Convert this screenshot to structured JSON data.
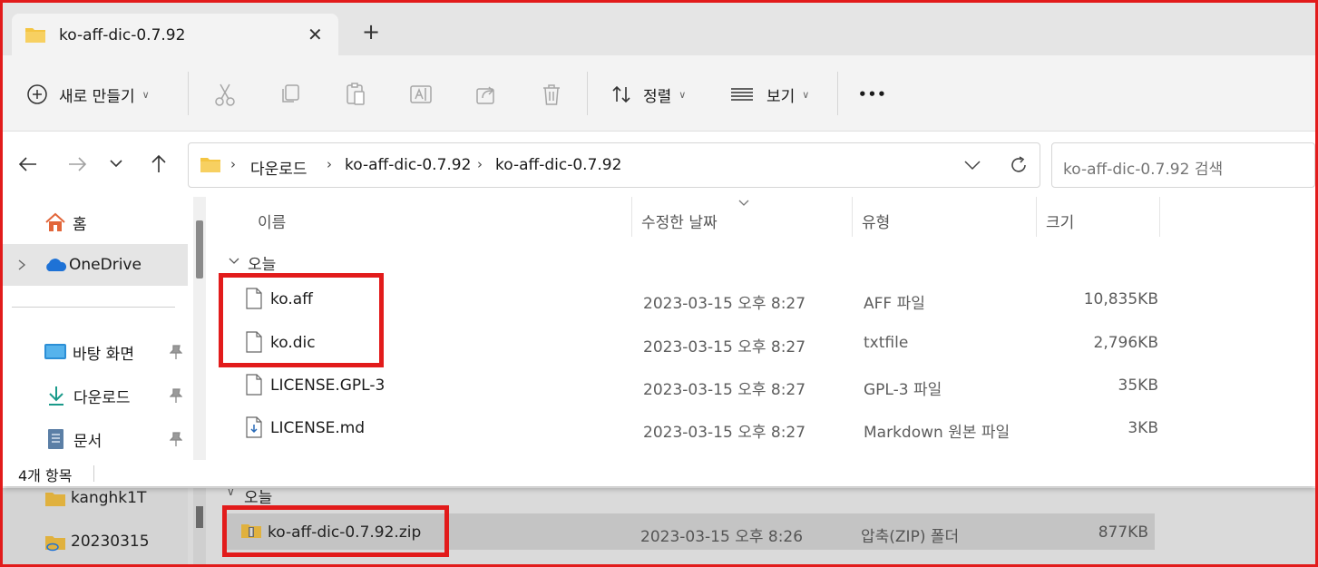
{
  "tab": {
    "title": "ko-aff-dic-0.7.92",
    "close_glyph": "✕",
    "add_glyph": "+"
  },
  "toolbar": {
    "new_label": "새로 만들기",
    "sort_label": "정렬",
    "view_label": "보기",
    "more_glyph": "•••"
  },
  "address": {
    "crumbs": [
      "다운로드",
      "ko-aff-dic-0.7.92",
      "ko-aff-dic-0.7.92"
    ]
  },
  "search": {
    "placeholder": "ko-aff-dic-0.7.92 검색"
  },
  "nav": {
    "items": [
      {
        "label": "홈",
        "icon": "home-icon"
      },
      {
        "label": "OneDrive",
        "icon": "cloud-icon"
      },
      {
        "label": "바탕 화면",
        "icon": "desktop-icon"
      },
      {
        "label": "다운로드",
        "icon": "download-icon"
      },
      {
        "label": "문서",
        "icon": "document-icon"
      }
    ]
  },
  "columns": {
    "name": "이름",
    "date": "수정한 날짜",
    "type": "유형",
    "size": "크기"
  },
  "group_label": "오늘",
  "files": [
    {
      "name": "ko.aff",
      "date": "2023-03-15 오후 8:27",
      "type": "AFF 파일",
      "size": "10,835KB",
      "icon": "file-icon"
    },
    {
      "name": "ko.dic",
      "date": "2023-03-15 오후 8:27",
      "type": "txtfile",
      "size": "2,796KB",
      "icon": "file-icon"
    },
    {
      "name": "LICENSE.GPL-3",
      "date": "2023-03-15 오후 8:27",
      "type": "GPL-3 파일",
      "size": "35KB",
      "icon": "file-icon"
    },
    {
      "name": "LICENSE.md",
      "date": "2023-03-15 오후 8:27",
      "type": "Markdown 원본 파일",
      "size": "3KB",
      "icon": "markdown-file-icon"
    }
  ],
  "status": {
    "count": "4개 항목"
  },
  "background_window": {
    "nav_items": [
      "kanghk1T",
      "20230315"
    ],
    "group_label": "오늘",
    "file": {
      "name": "ko-aff-dic-0.7.92.zip",
      "date": "2023-03-15 오후 8:26",
      "type": "압축(ZIP) 폴더",
      "size": "877KB"
    }
  },
  "colors": {
    "highlight": "#e21b1b",
    "folder": "#f4c542",
    "onedrive": "#1e72d6"
  }
}
